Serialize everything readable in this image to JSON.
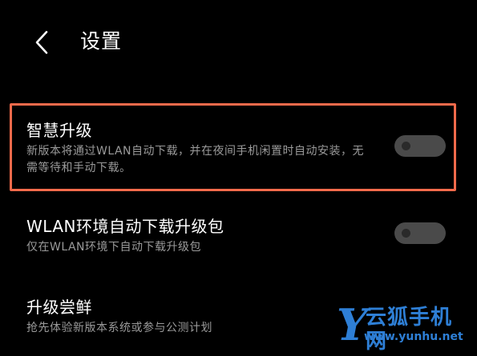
{
  "header": {
    "back_icon": "chevron-left-icon",
    "title": "设置"
  },
  "settings": [
    {
      "title": "智慧升级",
      "description": "新版本将通过WLAN自动下载，并在夜间手机闲置时自动安装，无需等待和手动下载。",
      "toggle_on": false,
      "highlighted": true
    },
    {
      "title": "WLAN环境自动下载升级包",
      "description": "仅在WLAN环境下自动下载升级包",
      "toggle_on": false
    },
    {
      "title": "升级尝鲜",
      "description": "抢先体验新版本系统或参与公测计划"
    }
  ],
  "watermark": {
    "logo": "Y",
    "brand": "云狐手机网",
    "url": "www.yunhu.net"
  },
  "colors": {
    "background": "#000000",
    "highlight": "#f26a4b",
    "toggle_track_off": "#4a4a4a",
    "secondary_text": "#9a9a9a",
    "watermark": "#2e7fd6"
  }
}
